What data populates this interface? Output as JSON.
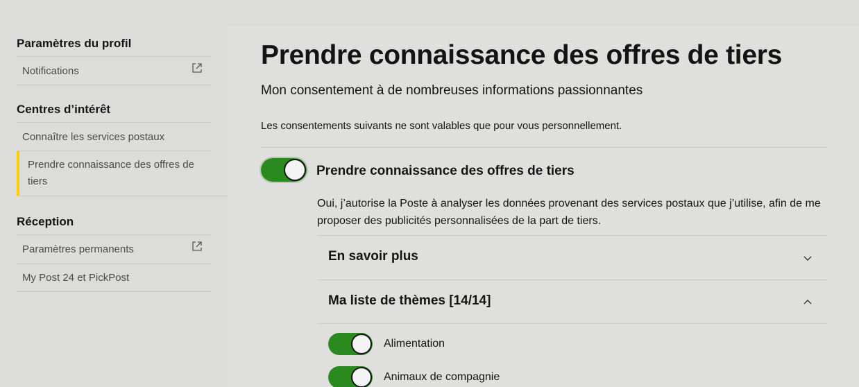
{
  "sidebar": {
    "sections": [
      {
        "title": "Paramètres du profil",
        "items": [
          {
            "label": "Notifications",
            "external": true
          }
        ]
      },
      {
        "title": "Centres d’intérêt",
        "items": [
          {
            "label": "Connaître les services postaux"
          },
          {
            "label": "Prendre connaissance des offres de tiers",
            "active": true
          }
        ]
      },
      {
        "title": "Réception",
        "items": [
          {
            "label": "Paramètres permanents",
            "external": true
          },
          {
            "label": "My Post 24 et PickPost"
          }
        ]
      }
    ]
  },
  "main": {
    "title": "Prendre connaissance des offres de tiers",
    "subtitle": "Mon consentement à de nombreuses informations passionnantes",
    "intro": "Les consentements suivants ne sont valables que pour vous personnellement.",
    "consent": {
      "label": "Prendre connaissance des offres de tiers",
      "enabled": true,
      "description": "Oui, j’autorise la Poste à analyser les données provenant des services postaux que j’utilise, afin de me proposer des publicités personnalisées de la part de tiers."
    },
    "accordions": [
      {
        "label": "En savoir plus",
        "expanded": false
      },
      {
        "label": "Ma liste de thèmes [14/14]",
        "expanded": true
      }
    ],
    "themes": [
      {
        "label": "Alimentation",
        "enabled": true
      },
      {
        "label": "Animaux de compagnie",
        "enabled": true
      }
    ]
  },
  "colors": {
    "toggle_on": "#2b8a1f",
    "active_marker": "#ffcc00",
    "background": "#dcdcdb"
  },
  "icons": {
    "external": "external-link-icon",
    "expand": "chevron-down-icon",
    "collapse": "chevron-up-icon"
  }
}
